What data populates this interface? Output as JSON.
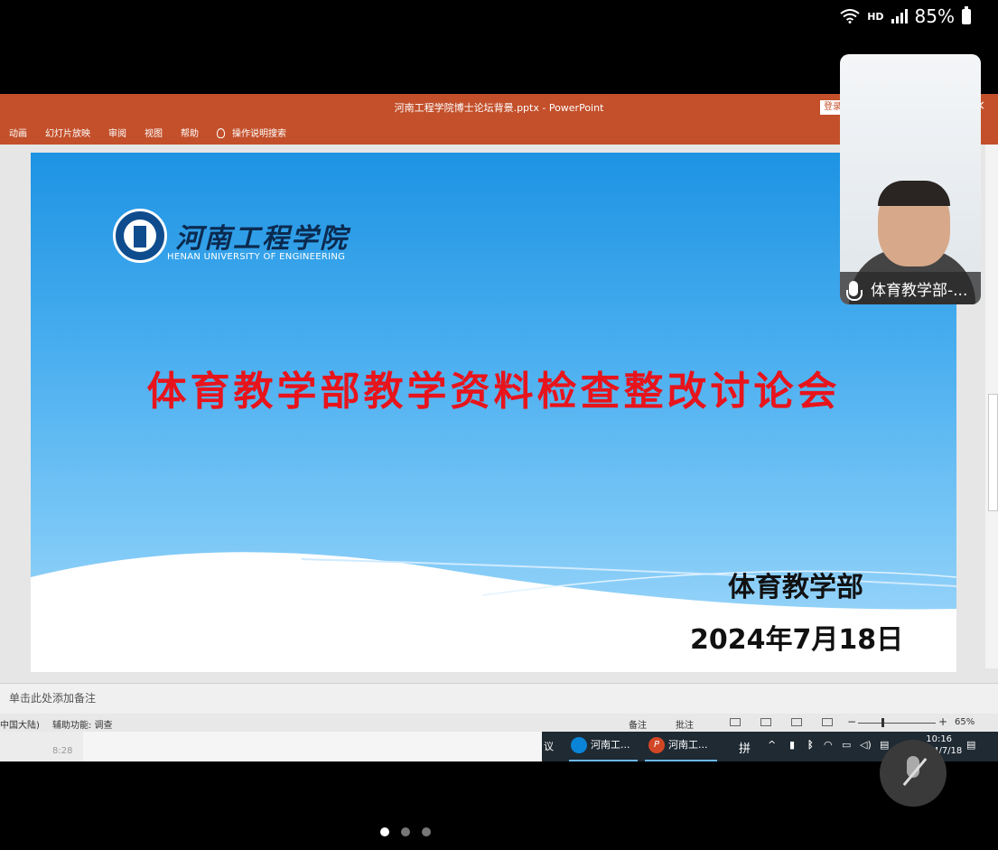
{
  "status_bar": {
    "network": "HD",
    "battery": "85%"
  },
  "window": {
    "title": "河南工程学院博士论坛背景.pptx  -  PowerPoint",
    "login_label": "登录",
    "close_label": "×"
  },
  "ribbon": {
    "tabs": [
      "动画",
      "幻灯片放映",
      "审阅",
      "视图",
      "帮助"
    ],
    "search_label": "操作说明搜索"
  },
  "slide": {
    "logo_cn": "河南工程学院",
    "logo_en": "HENAN UNIVERSITY OF ENGINEERING",
    "title": "体育教学部教学资料检查整改讨论会",
    "department": "体育教学部",
    "date": "2024年7月18日"
  },
  "notes_placeholder": "单击此处添加备注",
  "statusbar": {
    "language": "中国大陆)",
    "accessibility": "辅助功能: 调查",
    "notes_label": "备注",
    "comments_label": "批注",
    "zoom_minus": "−",
    "zoom_plus": "+",
    "zoom": "65%",
    "zoom_level": 0.3
  },
  "taskbar": {
    "ghost_time": "8:28",
    "cut_label": "议",
    "apps": [
      {
        "name": "edge",
        "label": "河南工..."
      },
      {
        "name": "powerpoint",
        "label": "河南工..."
      }
    ],
    "ime": "拼",
    "clock_time": "10:16",
    "clock_date": "2024/7/18"
  },
  "video": {
    "participant": "体育教学部-..."
  },
  "page_indicator": {
    "count": 3,
    "active": 0
  }
}
